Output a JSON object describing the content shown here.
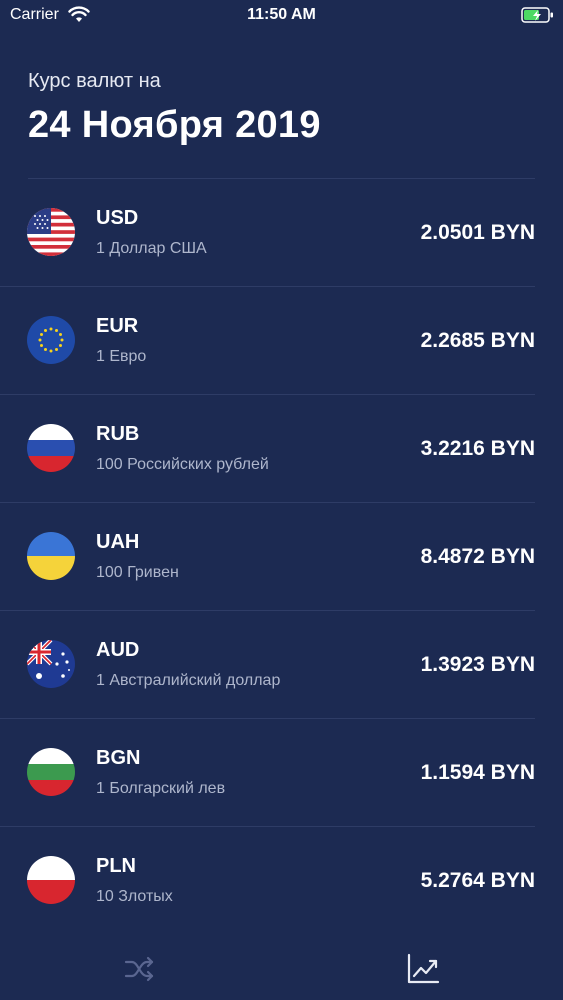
{
  "status_bar": {
    "carrier": "Carrier",
    "time": "11:50 AM",
    "wifi_icon": "wifi-icon",
    "battery_icon": "battery-charging-icon"
  },
  "header": {
    "subtitle": "Курс валют на",
    "date": "24 Ноября 2019"
  },
  "currencies": [
    {
      "code": "USD",
      "name": "1 Доллар США",
      "rate": "2.0501 BYN",
      "flag": "us-flag-icon"
    },
    {
      "code": "EUR",
      "name": "1 Евро",
      "rate": "2.2685 BYN",
      "flag": "eu-flag-icon"
    },
    {
      "code": "RUB",
      "name": "100 Российских рублей",
      "rate": "3.2216 BYN",
      "flag": "ru-flag-icon"
    },
    {
      "code": "UAH",
      "name": "100 Гривен",
      "rate": "8.4872 BYN",
      "flag": "ua-flag-icon"
    },
    {
      "code": "AUD",
      "name": "1 Австралийский доллар",
      "rate": "1.3923 BYN",
      "flag": "au-flag-icon"
    },
    {
      "code": "BGN",
      "name": "1 Болгарский лев",
      "rate": "1.1594 BYN",
      "flag": "bg-flag-icon"
    },
    {
      "code": "PLN",
      "name": "10 Злотых",
      "rate": "5.2764 BYN",
      "flag": "pl-flag-icon"
    }
  ],
  "tab_bar": {
    "tabs": [
      {
        "icon": "shuffle-icon",
        "active": false
      },
      {
        "icon": "chart-icon",
        "active": true
      }
    ]
  },
  "colors": {
    "background": "#1c2a52",
    "divider": "#2e3c66",
    "secondary_text": "#aeb6cc",
    "active_tab": "#ffffff",
    "inactive_tab": "#5a6690"
  }
}
